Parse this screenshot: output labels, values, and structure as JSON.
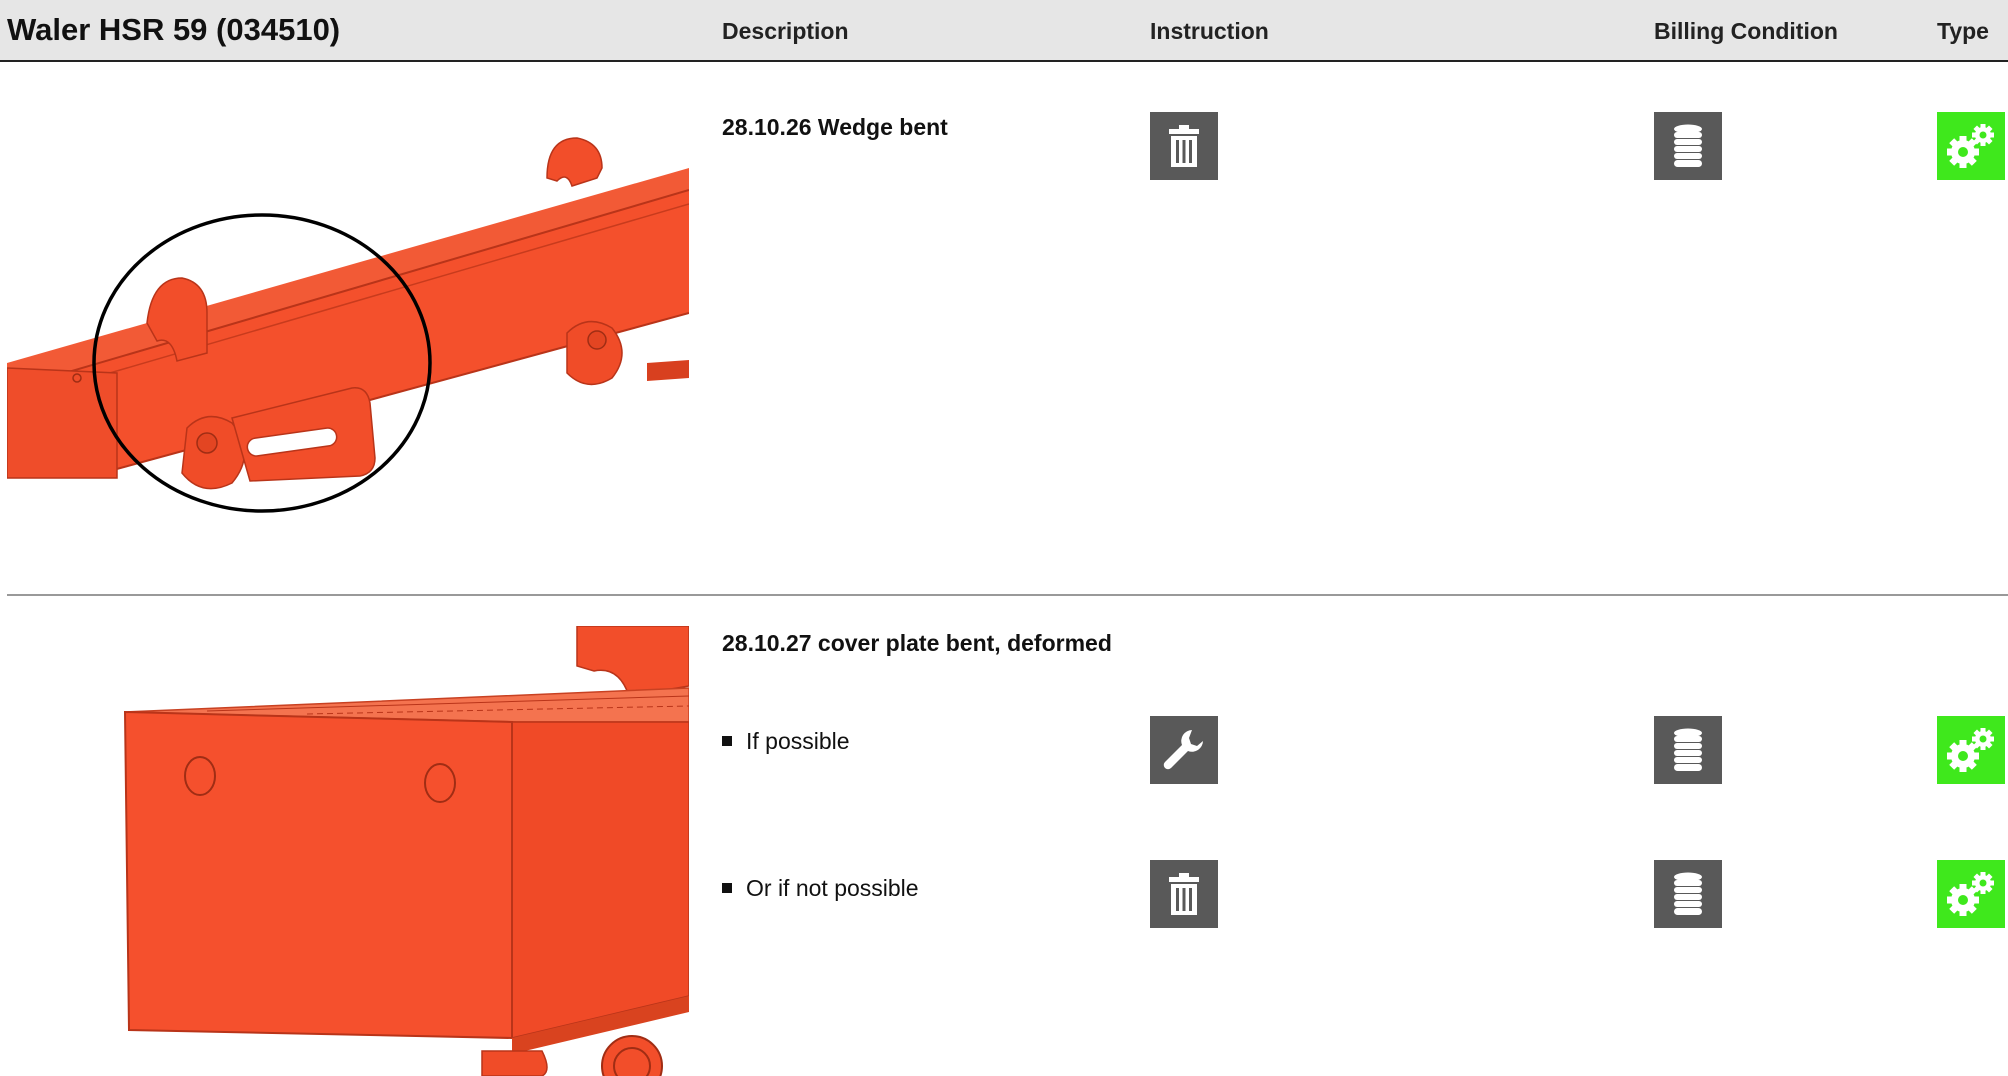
{
  "header": {
    "title": "Waler HSR 59 (034510)",
    "col_description": "Description",
    "col_instruction": "Instruction",
    "col_billing": "Billing Condition",
    "col_type": "Type"
  },
  "rows": [
    {
      "description": "28.10.26 Wedge bent",
      "instruction_icon": "trash-icon",
      "billing_icon": "coin-stack-icon",
      "type_icon": "gears-icon"
    },
    {
      "description": "28.10.27 cover plate bent, deformed",
      "items": [
        {
          "label": "If possible",
          "instruction_icon": "wrench-icon",
          "billing_icon": "coin-stack-icon",
          "type_icon": "gears-icon"
        },
        {
          "label": "Or if not possible",
          "instruction_icon": "trash-icon",
          "billing_icon": "coin-stack-icon",
          "type_icon": "gears-icon"
        }
      ]
    }
  ],
  "colors": {
    "header_bg": "#e6e6e6",
    "icon_gray": "#595959",
    "icon_green": "#3fe81c",
    "part_red": "#f5502d"
  }
}
